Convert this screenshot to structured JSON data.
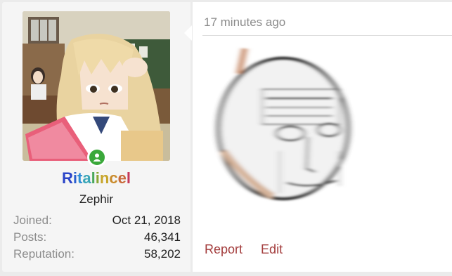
{
  "user": {
    "name": "Ritalincel",
    "name_colors": [
      "#2a44c8",
      "#2a5fd0",
      "#2f8fd6",
      "#3aa6b8",
      "#4aa85a",
      "#8aa635",
      "#c7a52a",
      "#c98a2a",
      "#c86a3a",
      "#c63a5a"
    ],
    "title": "Zephir",
    "status_icon": "user-online-icon",
    "stats": [
      {
        "label": "Joined:",
        "value": "Oct 21, 2018"
      },
      {
        "label": "Posts:",
        "value": "46,341"
      },
      {
        "label": "Reputation:",
        "value": "58,202"
      }
    ]
  },
  "message": {
    "timestamp": "17 minutes ago",
    "actions": {
      "report": "Report",
      "edit": "Edit"
    }
  },
  "colors": {
    "link": "#a33c3c",
    "muted": "#8c8c8c",
    "online": "#3aa83a"
  }
}
